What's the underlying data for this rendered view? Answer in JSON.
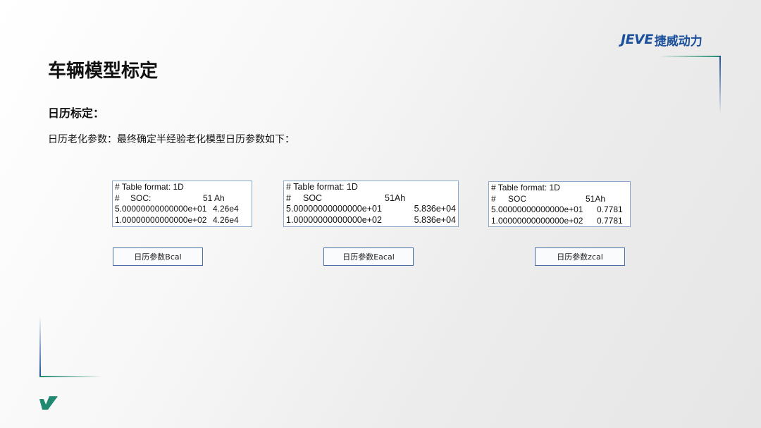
{
  "logo": {
    "latin": "JEVE",
    "chinese": "捷威动力"
  },
  "page_title": "车辆模型标定",
  "section_title": "日历标定：",
  "description": "日历老化参数：最终确定半经验老化模型日历参数如下：",
  "tables": [
    {
      "header": "# Table format: 1D",
      "hash": "#",
      "col_label": "SOC:",
      "col_value": "51 Ah",
      "rows": [
        {
          "x": "5.00000000000000e+01",
          "v": "4.26e4"
        },
        {
          "x": "1.00000000000000e+02",
          "v": "4.26e4"
        }
      ],
      "caption": "日历参数Bcal"
    },
    {
      "header": "# Table format: 1D",
      "hash": "#",
      "col_label": "SOC",
      "col_value": "51Ah",
      "rows": [
        {
          "x": "5.00000000000000e+01",
          "v": "5.836e+04"
        },
        {
          "x": "1.00000000000000e+02",
          "v": "5.836e+04"
        }
      ],
      "caption": "日历参数Eacal"
    },
    {
      "header": "# Table format: 1D",
      "hash": "#",
      "col_label": "SOC",
      "col_value": "51Ah",
      "rows": [
        {
          "x": "5.00000000000000e+01",
          "v": "0.7781"
        },
        {
          "x": "1.00000000000000e+02",
          "v": "0.7781"
        }
      ],
      "caption": "日历参数zcal"
    }
  ],
  "colors": {
    "brand_blue": "#1a4f9c",
    "brand_green": "#1f8a70",
    "box_border": "#8aa8c8",
    "caption_border": "#4a6fa5"
  },
  "icons": {
    "corner_mark": "jeve-check-mark-icon"
  }
}
